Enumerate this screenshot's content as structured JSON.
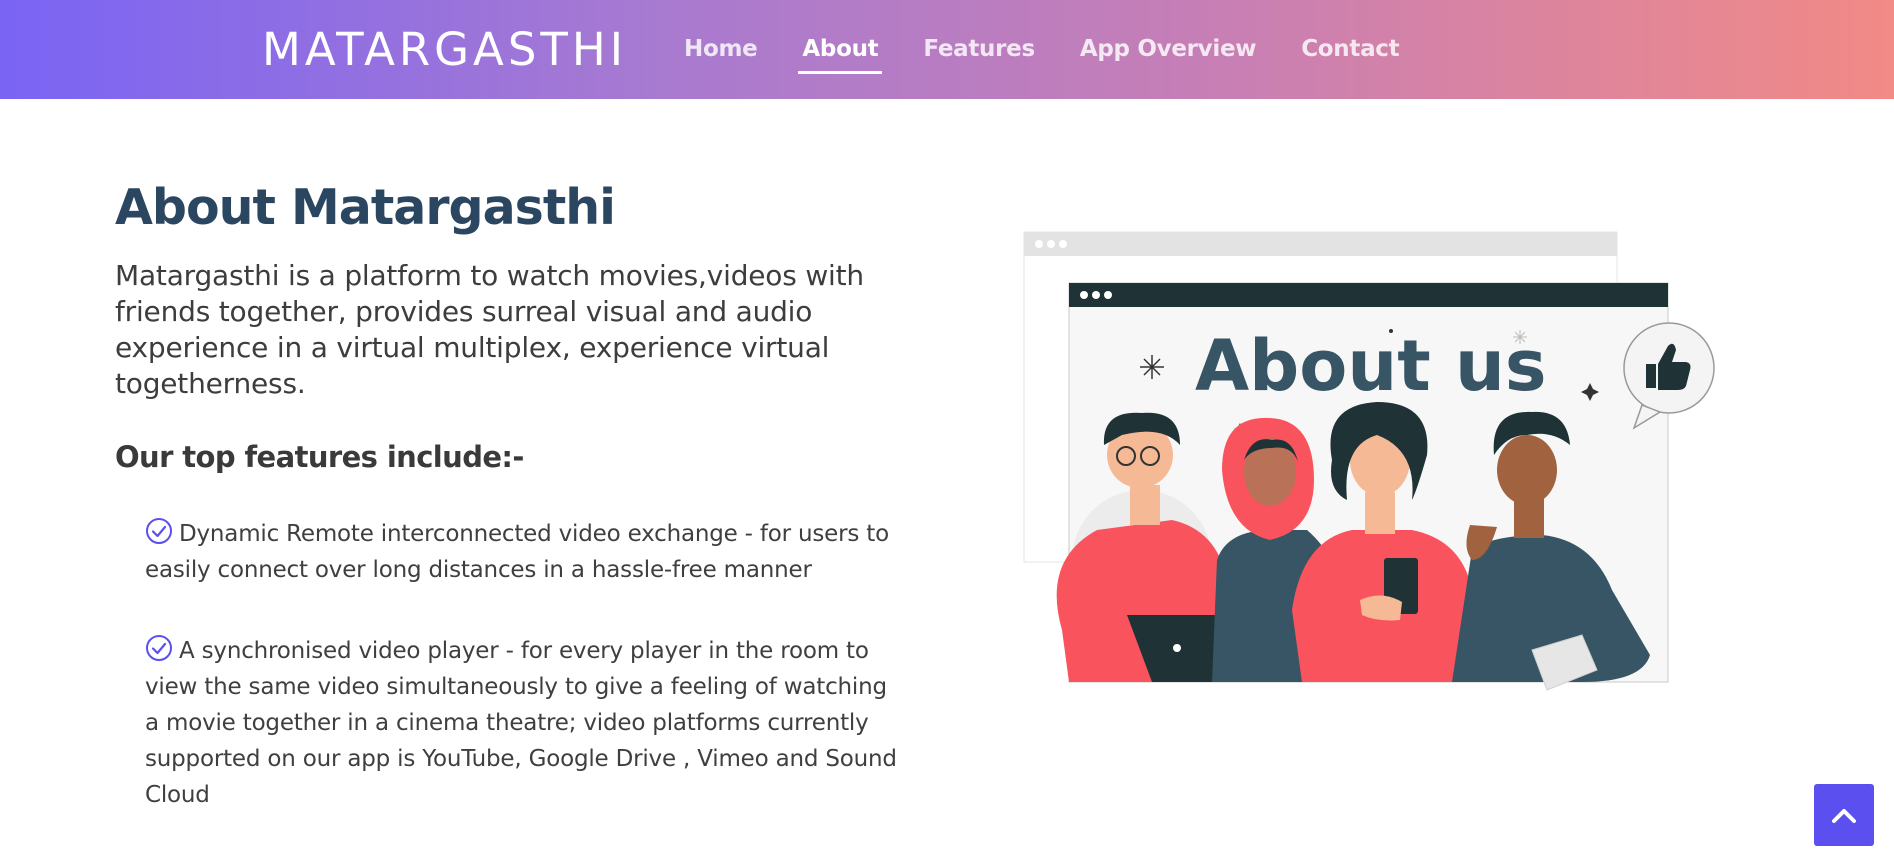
{
  "navbar": {
    "brand": "MATARGASTHI",
    "links": [
      {
        "label": "Home"
      },
      {
        "label": "About"
      },
      {
        "label": "Features"
      },
      {
        "label": "App Overview"
      },
      {
        "label": "Contact"
      }
    ],
    "active": "About"
  },
  "about": {
    "title": "About Matargasthi",
    "description": "Matargasthi is a platform to watch movies,videos with friends together, provides surreal visual and audio experience in a virtual multiplex, experience virtual togetherness.",
    "features_heading": "Our top features include:-",
    "features": [
      {
        "text": "Dynamic Remote interconnected video exchange - for users to easily connect over long distances in a hassle-free manner"
      },
      {
        "text": "A synchronised video player - for every player in the room to view the same video simultaneously to give a feeling of watching a movie together in a cinema theatre; video platforms currently supported on our app is YouTube, Google Drive , Vimeo and Sound Cloud"
      }
    ]
  },
  "illustration": {
    "heading": "About us"
  },
  "colors": {
    "title": "#2b4660",
    "accent": "#5b4ff0",
    "coral": "#f9545e",
    "dark_teal": "#375564"
  },
  "icons": {
    "feature_bullet": "check-circle-icon",
    "back_to_top": "chevron-up-icon"
  }
}
